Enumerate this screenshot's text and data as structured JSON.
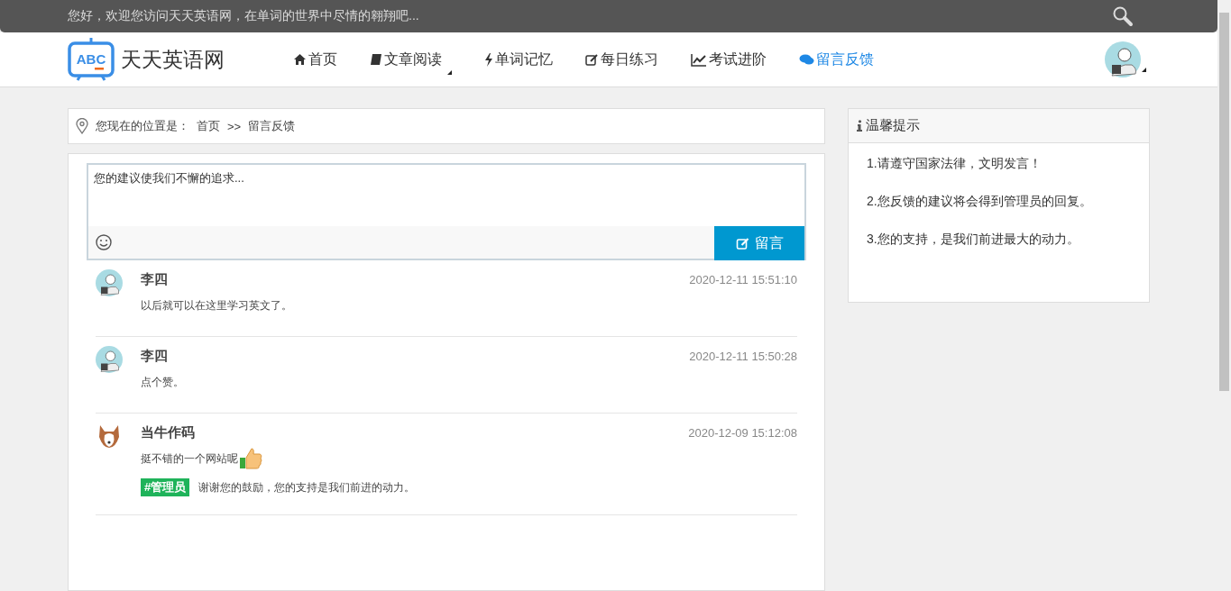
{
  "top_bar": {
    "greeting": "您好，欢迎您访问天天英语网，在单词的世界中尽情的翱翔吧..."
  },
  "header": {
    "logo_badge": "ABC",
    "site_name": "天天英语网",
    "nav": [
      {
        "label": "首页",
        "selected": false,
        "dropdown": false
      },
      {
        "label": "文章阅读",
        "selected": false,
        "dropdown": true
      },
      {
        "label": "单词记忆",
        "selected": false,
        "dropdown": false
      },
      {
        "label": "每日练习",
        "selected": false,
        "dropdown": false
      },
      {
        "label": "考试进阶",
        "selected": false,
        "dropdown": false
      },
      {
        "label": "留言反馈",
        "selected": true,
        "dropdown": false
      }
    ]
  },
  "breadcrumb": {
    "prefix": "您现在的位置是：",
    "items": [
      "首页",
      "留言反馈"
    ],
    "separator": ">>"
  },
  "composer": {
    "placeholder": "您的建议使我们不懈的追求...",
    "submit": "留言"
  },
  "comments": [
    {
      "name": "李四",
      "kind": "person",
      "time": "2020-12-11 15:51:10",
      "text": "以后就可以在这里学习英文了。",
      "thumbs_up": false
    },
    {
      "name": "李四",
      "kind": "person",
      "time": "2020-12-11 15:50:28",
      "text": "点个赞。",
      "thumbs_up": false
    },
    {
      "name": "当牛作码",
      "kind": "dog",
      "time": "2020-12-09 15:12:08",
      "text": "挺不错的一个网站呢",
      "thumbs_up": true,
      "reply": {
        "tag": "#管理员",
        "text": "谢谢您的鼓励，您的支持是我们前进的动力。"
      }
    }
  ],
  "tips": {
    "title": "温馨提示",
    "items": [
      "1.请遵守国家法律，文明发言！",
      "2.您反馈的建议将会得到管理员的回复。",
      "3.您的支持，是我们前进最大的动力。"
    ]
  }
}
